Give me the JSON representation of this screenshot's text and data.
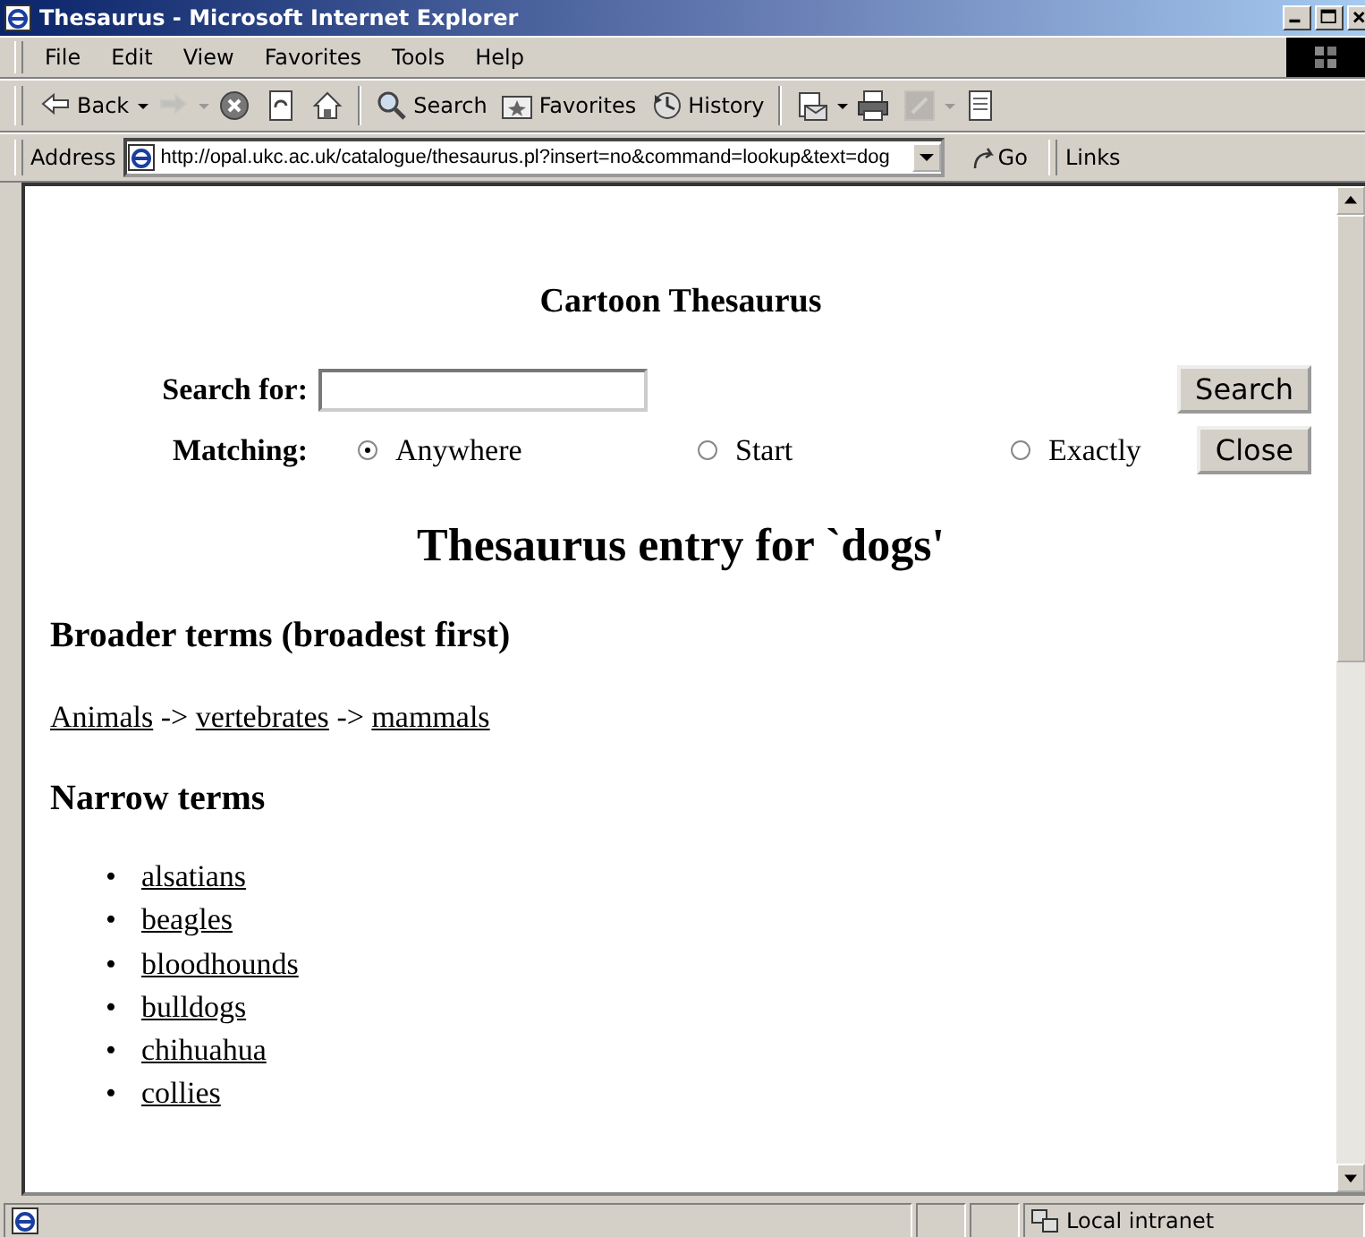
{
  "window": {
    "title": "Thesaurus - Microsoft Internet Explorer"
  },
  "menu": [
    "File",
    "Edit",
    "View",
    "Favorites",
    "Tools",
    "Help"
  ],
  "toolbar": [
    {
      "kind": "back",
      "label": "Back",
      "disabled": false
    },
    {
      "kind": "forward",
      "disabled": true
    },
    {
      "kind": "stop",
      "disabled": false
    },
    {
      "kind": "refresh",
      "disabled": false
    },
    {
      "kind": "home",
      "disabled": false
    },
    {
      "kind": "search",
      "label": "Search",
      "disabled": false
    },
    {
      "kind": "favorites",
      "label": "Favorites",
      "disabled": false
    },
    {
      "kind": "history",
      "label": "History",
      "disabled": false
    },
    {
      "kind": "mail",
      "disabled": false
    },
    {
      "kind": "print",
      "disabled": false
    },
    {
      "kind": "edit",
      "disabled": true
    },
    {
      "kind": "discuss",
      "disabled": false
    }
  ],
  "address": {
    "label": "Address",
    "value": "http://opal.ukc.ac.uk/catalogue/thesaurus.pl?insert=no&command=lookup&text=dog",
    "go": "Go",
    "links": "Links"
  },
  "page": {
    "title": "Cartoon Thesaurus",
    "search_label": "Search for:",
    "matching_label": "Matching:",
    "options": [
      {
        "label": "Anywhere",
        "selected": true
      },
      {
        "label": "Start",
        "selected": false
      },
      {
        "label": "Exactly",
        "selected": false
      }
    ],
    "buttons": [
      "Search",
      "Close"
    ],
    "heading": "Thesaurus entry for `dogs'",
    "broader_heading": "Broader terms (broadest first)",
    "broader": [
      "Animals",
      "vertebrates",
      "mammals"
    ],
    "separator": "->",
    "narrow_heading": "Narrow terms",
    "bullet": "•",
    "narrow": [
      "alsatians",
      "beagles",
      "bloodhounds",
      "bulldogs",
      "chihuahua",
      "collies"
    ]
  },
  "status_bar": {
    "zone": "Local intranet"
  }
}
